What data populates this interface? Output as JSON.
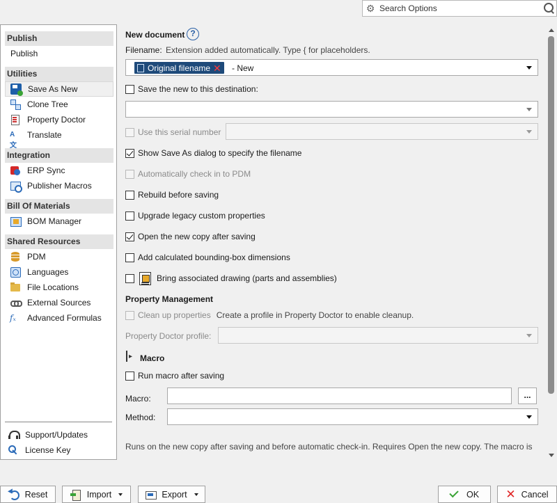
{
  "search": {
    "placeholder": "Search Options"
  },
  "sidebar": {
    "sections": [
      {
        "title": "Publish",
        "items": [
          {
            "label": "Publish",
            "icon": "none"
          }
        ]
      },
      {
        "title": "Utilities",
        "items": [
          {
            "label": "Save As New",
            "icon": "save-as-icon",
            "selected": true
          },
          {
            "label": "Clone Tree",
            "icon": "clone-tree-icon"
          },
          {
            "label": "Property Doctor",
            "icon": "property-doctor-icon"
          },
          {
            "label": "Translate",
            "icon": "translate-icon"
          }
        ]
      },
      {
        "title": "Integration",
        "items": [
          {
            "label": "ERP Sync",
            "icon": "erp-sync-icon"
          },
          {
            "label": "Publisher Macros",
            "icon": "publisher-macros-icon"
          }
        ]
      },
      {
        "title": "Bill Of Materials",
        "items": [
          {
            "label": "BOM Manager",
            "icon": "bom-manager-icon"
          }
        ]
      },
      {
        "title": "Shared Resources",
        "items": [
          {
            "label": "PDM",
            "icon": "pdm-icon"
          },
          {
            "label": "Languages",
            "icon": "languages-icon"
          },
          {
            "label": "File Locations",
            "icon": "file-locations-icon"
          },
          {
            "label": "External Sources",
            "icon": "external-sources-icon"
          },
          {
            "label": "Advanced Formulas",
            "icon": "advanced-formulas-icon"
          }
        ]
      }
    ],
    "bottom": [
      {
        "label": "Support/Updates",
        "icon": "support-icon"
      },
      {
        "label": "License Key",
        "icon": "license-key-icon"
      }
    ]
  },
  "main": {
    "new_document": {
      "title": "New document",
      "help": "?",
      "filename_label": "Filename:",
      "filename_hint": "Extension added automatically. Type { for placeholders.",
      "chip_label": "Original filename",
      "chip_remove": "✕",
      "suffix": "- New"
    },
    "options": {
      "save_destination": {
        "label": "Save the new to this destination:",
        "checked": false
      },
      "serial_number": {
        "label": "Use this serial number",
        "checked": false,
        "disabled": true
      },
      "show_save_as": {
        "label": "Show Save As dialog to specify the filename",
        "checked": true
      },
      "auto_checkin": {
        "label": "Automatically check in to PDM",
        "checked": false,
        "disabled": true
      },
      "rebuild": {
        "label": "Rebuild before saving",
        "checked": false
      },
      "upgrade_legacy": {
        "label": "Upgrade legacy custom properties",
        "checked": false
      },
      "open_new_copy": {
        "label": "Open the new copy after saving",
        "checked": true
      },
      "bounding_box": {
        "label": "Add calculated bounding-box dimensions",
        "checked": false
      },
      "bring_drawing": {
        "label": "Bring associated drawing (parts and assemblies)",
        "checked": false
      }
    },
    "property_management": {
      "title": "Property Management",
      "cleanup_label": "Clean up properties",
      "cleanup_hint": "Create a profile in Property Doctor to enable cleanup.",
      "profile_label": "Property Doctor profile:"
    },
    "macro": {
      "title": "Macro",
      "run_after": "Run macro after saving",
      "macro_label": "Macro:",
      "browse": "...",
      "method_label": "Method:",
      "note": "Runs on the new copy after saving and before automatic check-in. Requires Open the new copy. The macro is"
    }
  },
  "footer": {
    "reset": "Reset",
    "import": "Import",
    "export": "Export",
    "ok": "OK",
    "cancel": "Cancel"
  },
  "colors": {
    "chip_bg": "#1e4a7a",
    "chip_remove": "#ff3a3a",
    "help_ring": "#2a5fa5",
    "ok_check": "#3aa335",
    "cancel_x": "#e02424"
  }
}
